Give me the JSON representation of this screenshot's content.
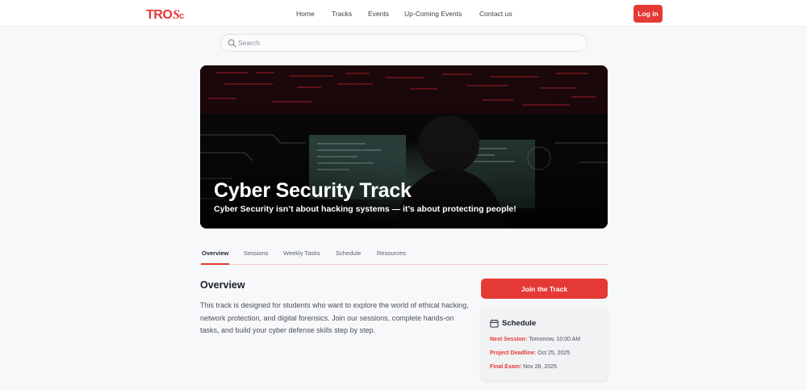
{
  "header": {
    "logo_text": "TROSc",
    "nav": [
      {
        "label": "Home"
      },
      {
        "label": "Tracks"
      },
      {
        "label": "Events"
      },
      {
        "label": "Up-Coming Events"
      },
      {
        "label": "Contact us"
      }
    ],
    "login_label": "Log in"
  },
  "search": {
    "placeholder": "Search",
    "value": "",
    "icon": "search-icon"
  },
  "hero": {
    "title": "Cyber Security Track",
    "subtitle": "Cyber Security isn’t about hacking systems — it’s about protecting people!"
  },
  "tabs": [
    {
      "label": "Overview",
      "active": true
    },
    {
      "label": "Sessions"
    },
    {
      "label": "Weekly Tasks"
    },
    {
      "label": "Schedule"
    },
    {
      "label": "Resources"
    }
  ],
  "overview": {
    "title": "Overview",
    "text": "This track is designed for students who want to explore the world of ethical hacking, network protection, and digital forensics. Join our sessions, complete hands-on tasks, and build your cyber defense skills step by step."
  },
  "sidebar": {
    "join_label": "Join the Track",
    "schedule": {
      "title": "Schedule",
      "icon": "calendar-icon",
      "rows": [
        {
          "label": "Next Session:",
          "value": "Tomorrow, 10:00 AM"
        },
        {
          "label": "Project Deadline:",
          "value": "Oct 25, 2025"
        },
        {
          "label": "Final Exam:",
          "value": "Nov 28, 2025"
        }
      ]
    }
  },
  "colors": {
    "accent": "#e53935",
    "background": "#f7f8fa",
    "card": "#f1f2f4"
  }
}
